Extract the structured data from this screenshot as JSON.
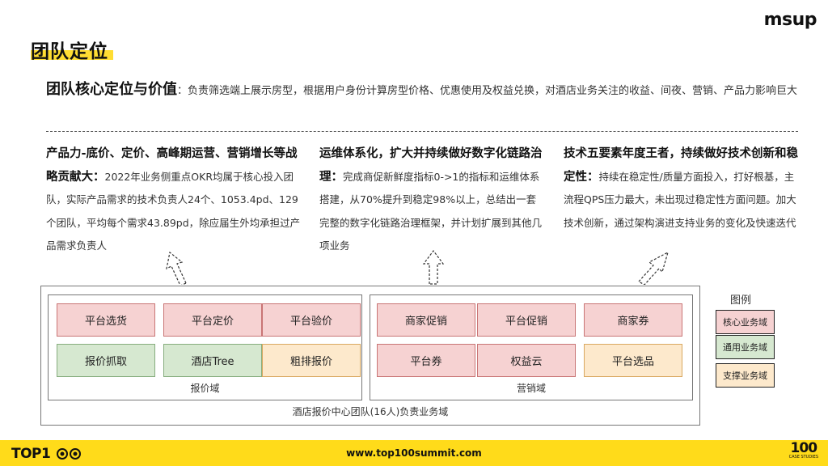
{
  "header": {
    "title": "团队定位",
    "brand_logo": "msup"
  },
  "core": {
    "heading": "团队核心定位与价值",
    "sep": "：",
    "text": "负责筛选端上展示房型，根据用户身份计算房型价格、优惠使用及权益兑换，对酒店业务关注的收益、间夜、营销、产品力影响巨大"
  },
  "columns": [
    {
      "heading": "产品力-底价、定价、高峰期运营、营销增长等战略贡献大：",
      "text": "2022年业务侧重点OKR均属于核心投入团队，实际产品需求的技术负责人24个、1053.4pd、129个团队，平均每个需求43.89pd，除应届生外均承担过产品需求负责人"
    },
    {
      "heading": "运维体系化，扩大并持续做好数字化链路治理：",
      "text": "完成商促新鲜度指标0->1的指标和运维体系搭建，从70%提升到稳定98%以上，总结出一套完整的数字化链路治理框架，并计划扩展到其他几项业务"
    },
    {
      "heading": "技术五要素年度王者，持续做好技术创新和稳定性：",
      "text": "持续在稳定性/质量方面投入，打好根基，主流程QPS压力最大，未出现过稳定性方面问题。加大技术创新，通过架构演进支持业务的变化及快速迭代"
    }
  ],
  "diagram": {
    "outer_label": "酒店报价中心团队(16人)负责业务域",
    "domains": [
      {
        "label": "报价域",
        "boxes": [
          {
            "label": "平台选货",
            "type": "core"
          },
          {
            "label": "平台定价",
            "type": "core"
          },
          {
            "label": "平台验价",
            "type": "core"
          },
          {
            "label": "报价抓取",
            "type": "general"
          },
          {
            "label": "酒店Tree",
            "type": "general"
          },
          {
            "label": "粗排报价",
            "type": "support"
          }
        ]
      },
      {
        "label": "营销域",
        "boxes": [
          {
            "label": "商家促销",
            "type": "core"
          },
          {
            "label": "平台促销",
            "type": "core"
          },
          {
            "label": "商家券",
            "type": "core"
          },
          {
            "label": "平台券",
            "type": "core"
          },
          {
            "label": "权益云",
            "type": "core"
          },
          {
            "label": "平台选品",
            "type": "support"
          }
        ]
      }
    ]
  },
  "legend": {
    "title": "图例",
    "items": [
      {
        "label": "核心业务域",
        "color": "#f6d2d2"
      },
      {
        "label": "通用业务域",
        "color": "#d6e8d0"
      },
      {
        "label": "支撑业务域",
        "color": "#fde9cc"
      }
    ]
  },
  "footer": {
    "brand_left": "TOP1",
    "url": "www.top100summit.com",
    "brand_right": "100",
    "brand_right_sub": "CASE STUDIES"
  },
  "colors": {
    "accent_yellow": "#ffdb1a",
    "core": "#f6d2d2",
    "general": "#d6e8d0",
    "support": "#fde9cc"
  },
  "icons": [
    "dashed-up-arrow-icon",
    "eye-icon"
  ]
}
